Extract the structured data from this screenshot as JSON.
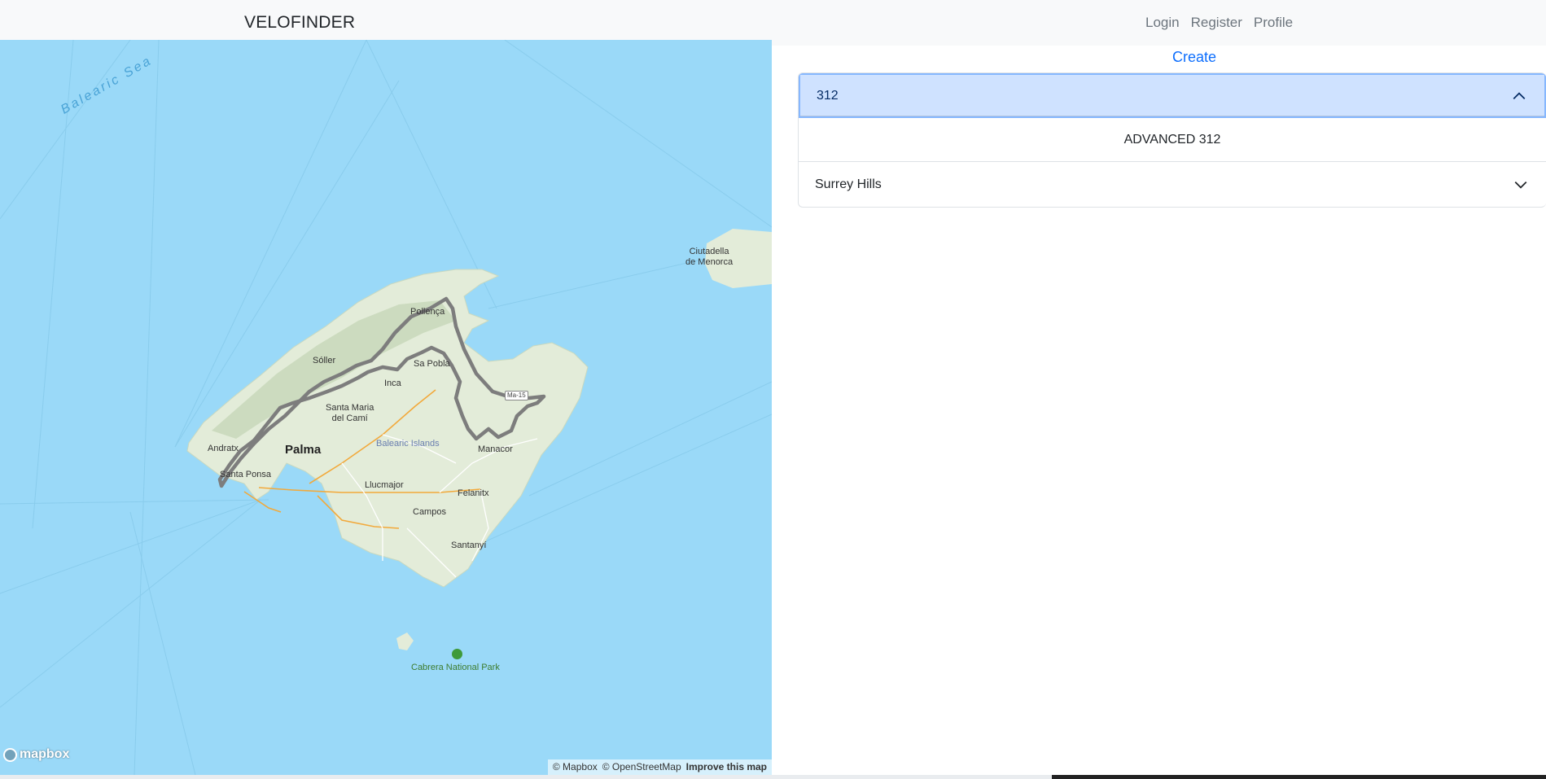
{
  "navbar": {
    "brand": "VELOFINDER",
    "links": [
      "Login",
      "Register",
      "Profile"
    ]
  },
  "map": {
    "labels": {
      "sea": "Balearic Sea",
      "ciutadella_1": "Ciutadella",
      "ciutadella_2": "de Menorca",
      "pollenca": "Pollença",
      "soller": "Sóller",
      "inca": "Inca",
      "sa_pobla": "Sa Pobla",
      "santa_maria_1": "Santa Maria",
      "santa_maria_2": "del Camí",
      "balearic_islands": "Balearic Islands",
      "andratx": "Andratx",
      "palma": "Palma",
      "manacor": "Manacor",
      "santa_ponsa": "Santa Ponsa",
      "llucmajor": "Llucmajor",
      "felanitx": "Felanitx",
      "campos": "Campos",
      "santanyi": "Santanyí",
      "cabrera": "Cabrera National Park",
      "road_shield": "Ma-15"
    },
    "logo_text": "mapbox",
    "attribution": {
      "mapbox": "© Mapbox",
      "osm": "© OpenStreetMap",
      "improve": "Improve this map"
    }
  },
  "panel": {
    "create_label": "Create",
    "accordion": [
      {
        "title": "312",
        "expanded": true,
        "body": "ADVANCED 312"
      },
      {
        "title": "Surrey Hills",
        "expanded": false
      }
    ]
  },
  "colors": {
    "sea": "#9ad9f8",
    "land": "#e3ecd9",
    "route": "#7d7d7d",
    "link": "#0d6efd",
    "accordion_open_bg": "#cfe2ff"
  }
}
